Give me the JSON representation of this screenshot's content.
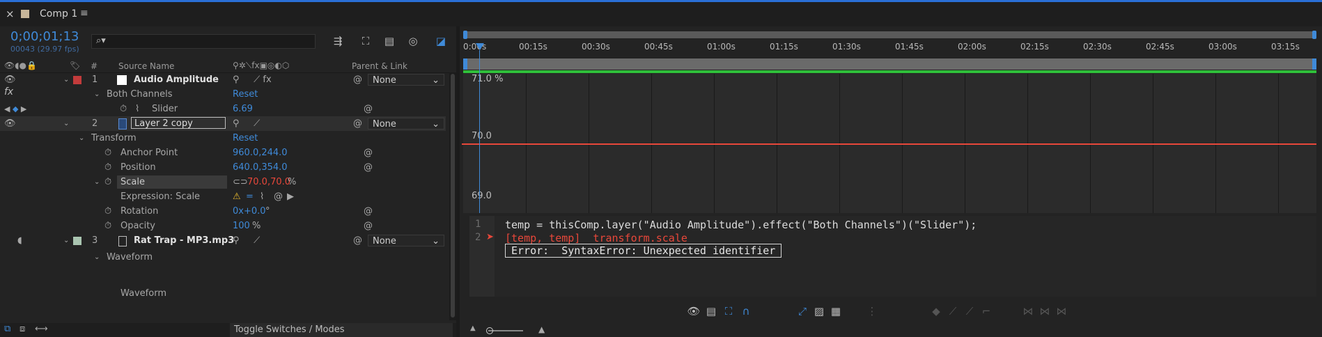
{
  "tab": {
    "close": "×",
    "title": "Comp 1",
    "menu": "≡"
  },
  "timecode": {
    "value": "0;00;01;13",
    "frames": "00043 (29.97 fps)"
  },
  "search": {
    "placeholder": ""
  },
  "columns": {
    "hash": "#",
    "source_name": "Source Name",
    "parent_link": "Parent & Link"
  },
  "layers": [
    {
      "num": "1",
      "name": "Audio Amplitude",
      "parent": "None",
      "label_color": "#c23b3b"
    },
    {
      "num": "2",
      "name": "Layer 2 copy",
      "parent": "None",
      "label_color": "#3a3a3a"
    },
    {
      "num": "3",
      "name": "Rat Trap - MP3.mp3",
      "parent": "None",
      "label_color": "#a9c4b0"
    }
  ],
  "effects": {
    "fx": "fx",
    "group": "Both Channels",
    "reset": "Reset",
    "slider_label": "Slider",
    "slider_value": "6.69"
  },
  "transform": {
    "label": "Transform",
    "reset": "Reset",
    "anchor": {
      "label": "Anchor Point",
      "value": "960.0,244.0"
    },
    "position": {
      "label": "Position",
      "value": "640.0,354.0"
    },
    "scale": {
      "label": "Scale",
      "value": "70.0,70.0",
      "unit": "%"
    },
    "expression": {
      "label": "Expression: Scale"
    },
    "rotation": {
      "label": "Rotation",
      "value": "0x+0.0",
      "unit": "°"
    },
    "opacity": {
      "label": "Opacity",
      "value": "100",
      "unit": "%"
    }
  },
  "waveform": {
    "group": "Waveform",
    "item": "Waveform"
  },
  "footer": {
    "toggle": "Toggle Switches / Modes"
  },
  "ruler": [
    "0:00s",
    "00:15s",
    "00:30s",
    "00:45s",
    "01:00s",
    "01:15s",
    "01:30s",
    "01:45s",
    "02:00s",
    "02:15s",
    "02:30s",
    "02:45s",
    "03:00s",
    "03:15s"
  ],
  "graph": {
    "top": "71.0 %",
    "mid": "70.0",
    "bottom": "69.0"
  },
  "editor": {
    "lines": [
      "1",
      "2"
    ],
    "line1": "temp = thisComp.layer(\"Audio Amplitude\").effect(\"Both Channels\")(\"Slider\");",
    "line2": "[temp, temp]  transform.scale",
    "error": "Error:  SyntaxError: Unexpected identifier"
  },
  "colors": {
    "accent": "#3f8ad8",
    "error": "#e8473a",
    "green": "#2fbf3a"
  }
}
